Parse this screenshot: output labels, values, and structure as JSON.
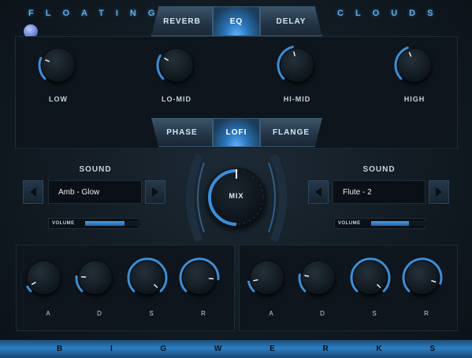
{
  "branding": {
    "title_left": "FLOATING",
    "title_right": "CLOUDS",
    "footer": "BIGWERKS"
  },
  "fx_tabs": [
    {
      "label": "REVERB",
      "active": false
    },
    {
      "label": "EQ",
      "active": true
    },
    {
      "label": "DELAY",
      "active": false
    }
  ],
  "eq_knobs": [
    {
      "label": "LOW",
      "value": 0.25
    },
    {
      "label": "LO-MID",
      "value": 0.28
    },
    {
      "label": "HI-MID",
      "value": 0.45
    },
    {
      "label": "HIGH",
      "value": 0.42
    }
  ],
  "mod_tabs": [
    {
      "label": "PHASE",
      "active": false
    },
    {
      "label": "LOFI",
      "active": true
    },
    {
      "label": "FLANGE",
      "active": false
    }
  ],
  "layer_a": {
    "sound_label": "SOUND",
    "preset": "Amb - Glow",
    "volume_label": "VOLUME",
    "volume": 0.72,
    "adsr": [
      {
        "label": "A",
        "value": 0.06
      },
      {
        "label": "D",
        "value": 0.18
      },
      {
        "label": "S",
        "value": 1.0
      },
      {
        "label": "R",
        "value": 0.85
      }
    ]
  },
  "layer_b": {
    "sound_label": "SOUND",
    "preset": "Flute - 2",
    "volume_label": "VOLUME",
    "volume": 0.68,
    "adsr": [
      {
        "label": "A",
        "value": 0.12
      },
      {
        "label": "D",
        "value": 0.2
      },
      {
        "label": "S",
        "value": 1.0
      },
      {
        "label": "R",
        "value": 0.9
      }
    ]
  },
  "mix": {
    "label": "MIX",
    "value": 0.5
  },
  "colors": {
    "accent": "#3a8fd8",
    "glow": "#5db2ff",
    "panel": "#0e151c"
  }
}
